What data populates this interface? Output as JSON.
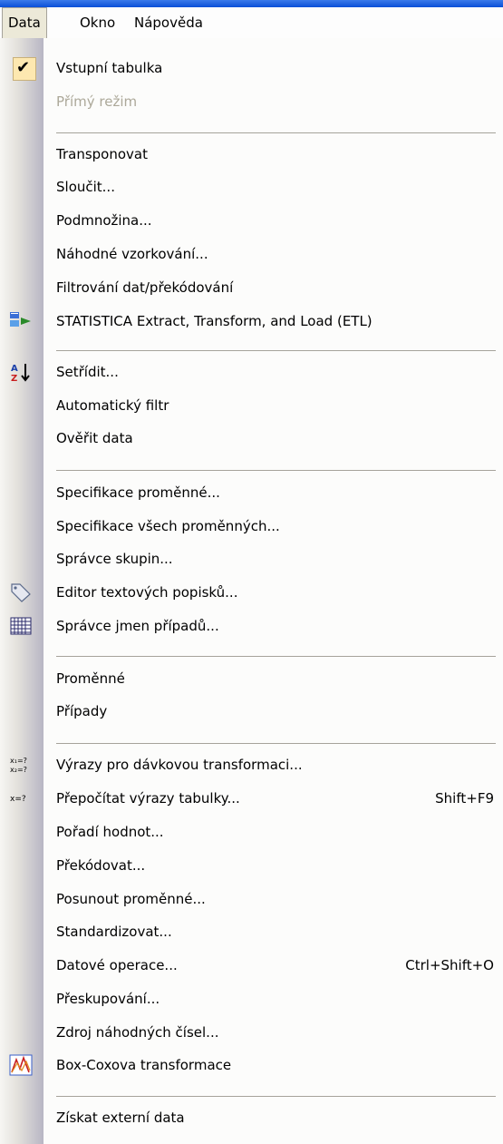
{
  "menubar": {
    "data": "Data",
    "okno": "Okno",
    "napoveda": "Nápověda"
  },
  "menu": {
    "vstupni_tabulka": "Vstupní tabulka",
    "primy_rezim": "Přímý režim",
    "transponovat": "Transponovat",
    "sloucit": "Sloučit...",
    "podmnozina": "Podmnožina...",
    "nahodne_vzorkovani": "Náhodné vzorkování...",
    "filtrovani": "Filtrování dat/překódování",
    "etl": "STATISTICA Extract, Transform, and Load (ETL)",
    "setridit": "Setřídit...",
    "automaticky_filtr": "Automatický filtr",
    "overit_data": "Ověřit data",
    "specifikace_promenne": "Specifikace proměnné...",
    "specifikace_vsech": "Specifikace všech proměnných...",
    "spravce_skupin": "Správce skupin...",
    "editor_popisku": "Editor textových popisků...",
    "spravce_jmen": "Správce jmen případů...",
    "promenne": "Proměnné",
    "pripady": "Případy",
    "vyrazy_davkova": "Výrazy pro dávkovou transformaci...",
    "prepocitat": "Přepočítat výrazy tabulky...",
    "prepocitat_shortcut": "Shift+F9",
    "poradi_hodnot": "Pořadí hodnot...",
    "prekodovat": "Překódovat...",
    "posunout": "Posunout proměnné...",
    "standardizovat": "Standardizovat...",
    "datove_operace": "Datové operace...",
    "datove_operace_shortcut": "Ctrl+Shift+O",
    "preskupovani": "Přeskupování...",
    "zdroj": "Zdroj náhodných čísel...",
    "box_cox": "Box-Coxova transformace",
    "ziskat": "Získat externí data"
  }
}
